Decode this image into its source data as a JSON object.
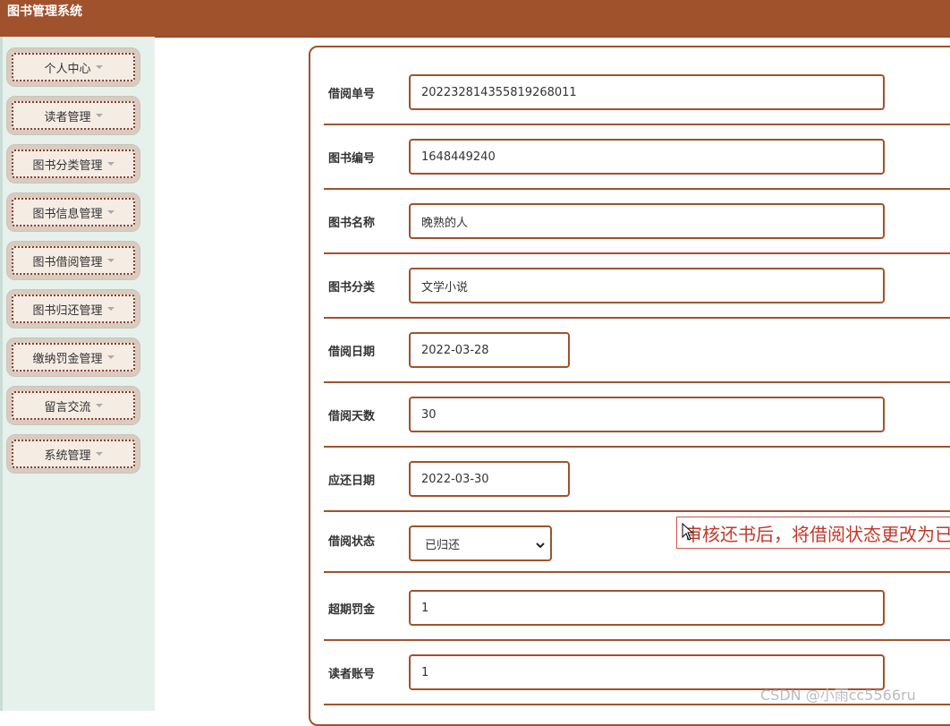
{
  "app": {
    "title": "图书管理系统"
  },
  "sidebar": {
    "items": [
      {
        "label": "个人中心"
      },
      {
        "label": "读者管理"
      },
      {
        "label": "图书分类管理"
      },
      {
        "label": "图书信息管理"
      },
      {
        "label": "图书借阅管理"
      },
      {
        "label": "图书归还管理"
      },
      {
        "label": "缴纳罚金管理"
      },
      {
        "label": "留言交流"
      },
      {
        "label": "系统管理"
      }
    ]
  },
  "form": {
    "borrow_no": {
      "label": "借阅单号",
      "value": "20223281435581926801​1"
    },
    "book_no": {
      "label": "图书编号",
      "value": "1648449240"
    },
    "book_name": {
      "label": "图书名称",
      "value": "晚熟的人"
    },
    "book_category": {
      "label": "图书分类",
      "value": "文学小说"
    },
    "borrow_date": {
      "label": "借阅日期",
      "value": "2022-03-28"
    },
    "borrow_days": {
      "label": "借阅天数",
      "value": "30"
    },
    "due_date": {
      "label": "应还日期",
      "value": "2022-03-30"
    },
    "borrow_status": {
      "label": "借阅状态",
      "value": "已归还"
    },
    "overdue_fine": {
      "label": "超期罚金",
      "value": "1"
    },
    "reader_account": {
      "label": "读者账号",
      "value": "1"
    }
  },
  "annotation": {
    "text": "审核还书后，将借阅状态更改为已"
  },
  "watermark": {
    "text": "CSDN @小雨cc5566ru"
  },
  "colors": {
    "brand": "#a0522d",
    "sidebar_bg": "#e6f1ec",
    "note_text": "#c0392b"
  },
  "icons": {
    "menu_caret": "caret-down-icon",
    "select_chevron": "chevron-down-icon",
    "cursor": "mouse-pointer-icon"
  }
}
